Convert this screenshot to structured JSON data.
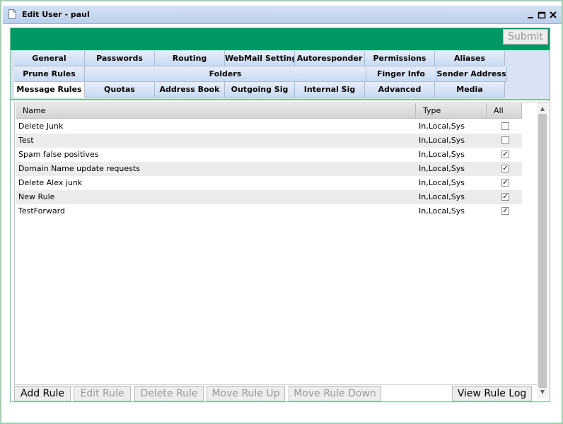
{
  "window": {
    "title": "Edit User - paul"
  },
  "toolbar": {
    "submit_label": "Submit"
  },
  "tabs": {
    "row1": [
      "General",
      "Passwords",
      "Routing",
      "WebMail Settings",
      "Autoresponder",
      "Permissions",
      "Aliases"
    ],
    "row2": [
      "Prune Rules",
      "Folders",
      "Finger Info",
      "Sender Address"
    ],
    "row3": [
      "Message Rules",
      "Quotas",
      "Address Book",
      "Outgoing Sig",
      "Internal Sig",
      "Advanced",
      "Media"
    ],
    "active": "Message Rules"
  },
  "grid": {
    "columns": [
      "Name",
      "Type",
      "All"
    ],
    "rows": [
      {
        "name": "Delete Junk",
        "type": "In,Local,Sys",
        "all": false
      },
      {
        "name": "Test",
        "type": "In,Local,Sys",
        "all": false
      },
      {
        "name": "Spam false positives",
        "type": "In,Local,Sys",
        "all": true
      },
      {
        "name": "Domain Name update requests",
        "type": "In,Local,Sys",
        "all": true
      },
      {
        "name": "Delete Alex junk",
        "type": "In,Local,Sys",
        "all": true
      },
      {
        "name": "New Rule",
        "type": "In,Local,Sys",
        "all": true
      },
      {
        "name": "TestForward",
        "type": "In,Local,Sys",
        "all": true
      }
    ]
  },
  "actions": {
    "add_rule": "Add Rule",
    "edit_rule": "Edit Rule",
    "delete_rule": "Delete Rule",
    "move_up": "Move Rule Up",
    "move_down": "Move Rule Down",
    "view_log": "View Rule Log"
  },
  "colors": {
    "accent_green": "#009966",
    "tab_bg": "#c9daf0",
    "titlebar_bg": "#bccfea"
  },
  "icons": {
    "document": "document-icon",
    "minimize": "minimize-icon",
    "maximize": "maximize-icon",
    "close": "close-icon"
  }
}
